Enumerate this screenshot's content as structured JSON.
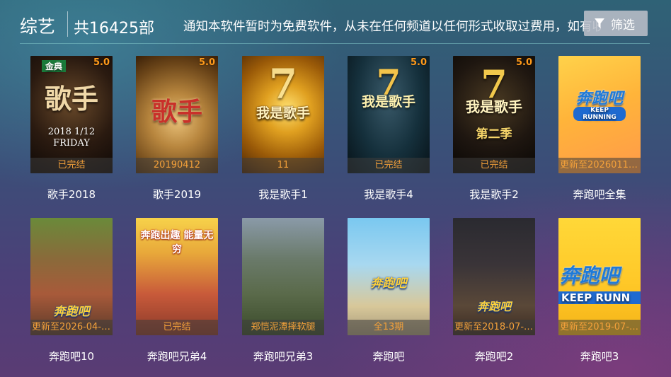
{
  "header": {
    "category": "综艺",
    "count": "共16425部",
    "notice": "通知本软件暂时为免费软件，从未在任何频道以任何形式收取过费用，如有收费，谨防受骗",
    "filter_label": "筛选"
  },
  "colors": {
    "badge_text": "#f4a13a",
    "score": "#ff9a1a"
  },
  "items": [
    {
      "title": "歌手2018",
      "badge": "已完结",
      "score": "5.0",
      "art_text": "歌手",
      "art_sub": "2018 1/12 FRIDAY",
      "logo": "金典"
    },
    {
      "title": "歌手2019",
      "badge": "20190412",
      "score": "5.0",
      "art_text": "歌手",
      "art_sub": "",
      "logo": ""
    },
    {
      "title": "我是歌手1",
      "badge": "11",
      "score": "",
      "art_text": "我是歌手",
      "art_sub": "",
      "logo": ""
    },
    {
      "title": "我是歌手4",
      "badge": "已完结",
      "score": "5.0",
      "art_text": "我是歌手",
      "art_sub": "",
      "logo": ""
    },
    {
      "title": "我是歌手2",
      "badge": "已完结",
      "score": "5.0",
      "art_text": "我是歌手",
      "art_sub": "第二季",
      "logo": ""
    },
    {
      "title": "奔跑吧全集",
      "badge": "更新至20260110...",
      "score": "",
      "art_text": "奔跑吧",
      "art_sub": "KEEP RUNNING",
      "logo": ""
    },
    {
      "title": "奔跑吧10",
      "badge": "更新至2026-04-2...",
      "score": "",
      "art_text": "奔跑吧",
      "art_sub": "",
      "logo": ""
    },
    {
      "title": "奔跑吧兄弟4",
      "badge": "已完结",
      "score": "",
      "art_text": "奔跑出趣 能量无穷",
      "art_sub": "",
      "logo": ""
    },
    {
      "title": "奔跑吧兄弟3",
      "badge": "郑恺泥潭摔软腿",
      "score": "",
      "art_text": "",
      "art_sub": "",
      "logo": ""
    },
    {
      "title": "奔跑吧",
      "badge": "全13期",
      "score": "",
      "art_text": "奔跑吧",
      "art_sub": "",
      "logo": ""
    },
    {
      "title": "奔跑吧2",
      "badge": "更新至2018-07-0...",
      "score": "",
      "art_text": "奔跑吧",
      "art_sub": "",
      "logo": ""
    },
    {
      "title": "奔跑吧3",
      "badge": "更新至2019-07-1...",
      "score": "",
      "art_text": "奔跑吧",
      "art_sub": "KEEP RUNN",
      "logo": ""
    }
  ]
}
